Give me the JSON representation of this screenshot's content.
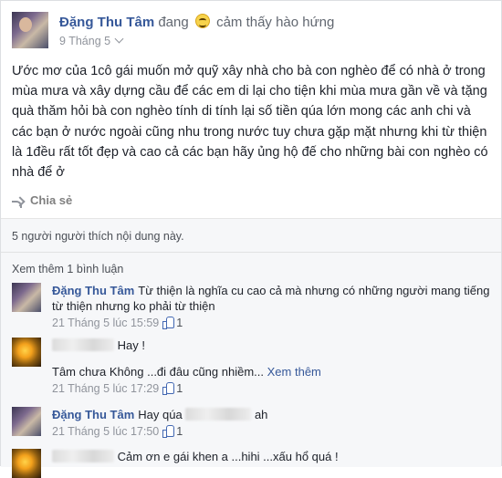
{
  "post": {
    "author": "Đặng Thu Tâm",
    "feeling_prefix": "đang",
    "feeling_icon": "grinning-face-icon",
    "feeling_text": "cảm thấy hào hứng",
    "date": "9 Tháng 5",
    "body": "Ước mơ của 1cô gái muốn mở quỹ xây nhà cho bà con nghèo để có nhà ở trong mùa mưa và xây dựng cầu để các em di lại cho tiện khi mùa mưa gần về và tặng quà thăm hỏi bà con nghèo tính di tính lại số tiền qúa lớn mong các anh chi và các bạn ở nước ngoài cũng nhu trong nước tuy chưa gặp mặt nhưng khi từ thiện là 1đều rất tốt đẹp và cao cả các bạn hãy ủng hộ đế cho những bài con nghèo có nhà để ở",
    "share_label": "Chia sẻ"
  },
  "ufi": {
    "likes_text": "5 người người thích nội dung này.",
    "view_more": "Xem thêm 1 bình luận"
  },
  "comments": [
    {
      "author": "Đặng Thu Tâm",
      "text": "Từ thiện là nghĩa cu cao cả mà nhưng có những người mang tiếng từ thiện nhưng ko phải từ thiện",
      "time": "21 Tháng 5 lúc 15:59",
      "likes": "1"
    },
    {
      "author": "",
      "text": "Hay !",
      "continuation": "Tâm chưa Không ...đi đâu cũng nhiềm...",
      "see_more": "Xem thêm",
      "time": "21 Tháng 5 lúc 17:29",
      "likes": "1"
    },
    {
      "author": "Đặng Thu Tâm",
      "text_before": "Hay qúa",
      "text_after": "ah",
      "time": "21 Tháng 5 lúc 17:50",
      "likes": "1"
    },
    {
      "author": "",
      "text": "Cảm ơn e gái khen a ...hihi ...xấu hổ quá !"
    }
  ],
  "colors": {
    "link": "#365899",
    "meta": "#90949c",
    "ufi_bg": "#f6f7f9",
    "like_blue": "#4267b2"
  }
}
